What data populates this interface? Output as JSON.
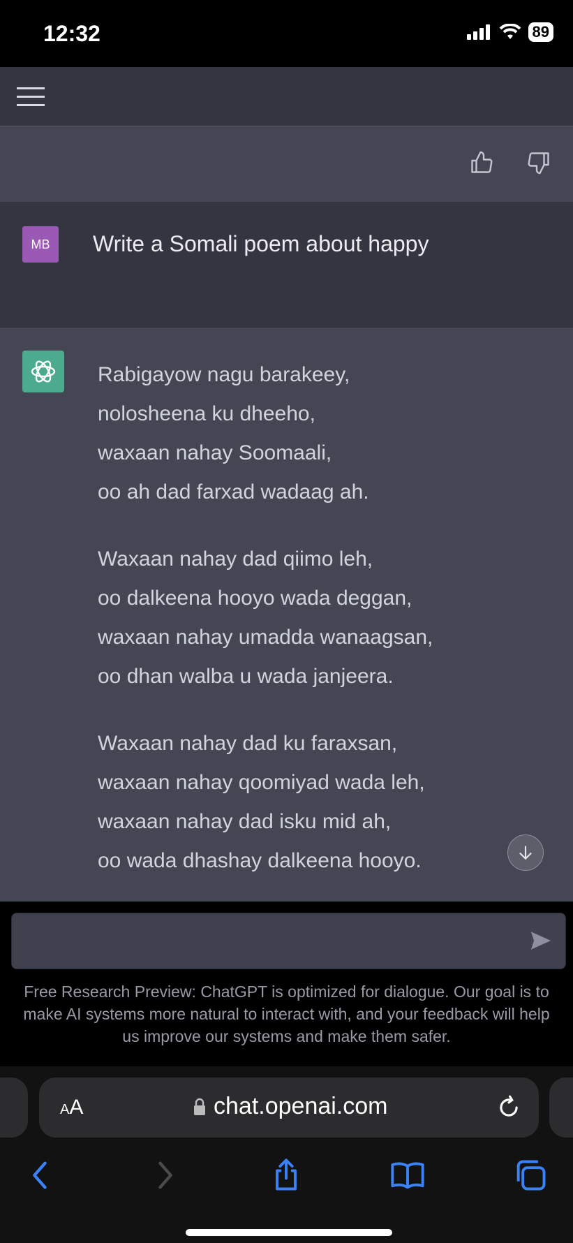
{
  "status_bar": {
    "time": "12:32",
    "battery": "89"
  },
  "header": {
    "menu_icon": "hamburger-icon"
  },
  "feedback": {
    "thumbs_up_icon": "thumbs-up-icon",
    "thumbs_down_icon": "thumbs-down-icon"
  },
  "user_message": {
    "avatar_initials": "MB",
    "text": "Write a Somali poem about happy"
  },
  "assistant_message": {
    "avatar_icon": "openai-logo-icon",
    "stanzas": [
      [
        "Rabigayow nagu barakeey,",
        "nolosheena ku dheeho,",
        "waxaan nahay Soomaali,",
        "oo ah dad farxad wadaag ah."
      ],
      [
        "Waxaan nahay dad qiimo leh,",
        "oo dalkeena hooyo wada deggan,",
        "waxaan nahay umadda wanaagsan,",
        "oo dhan walba u wada janjeera."
      ],
      [
        "Waxaan nahay dad ku faraxsan,",
        "waxaan nahay qoomiyad wada leh,",
        "waxaan nahay dad isku mid ah,",
        "oo wada dhashay dalkeena hooyo."
      ]
    ]
  },
  "composer": {
    "placeholder": "",
    "send_icon": "send-icon"
  },
  "disclaimer": "Free Research Preview: ChatGPT is optimized for dialogue. Our goal is to make AI systems more natural to interact with, and your feedback will help us improve our systems and make them safer.",
  "browser": {
    "aa_label": "AA",
    "url": "chat.openai.com"
  },
  "colors": {
    "background": "#343541",
    "assistant_bg": "#444654",
    "accent": "#10a37f",
    "user_avatar": "#9b59b6"
  }
}
